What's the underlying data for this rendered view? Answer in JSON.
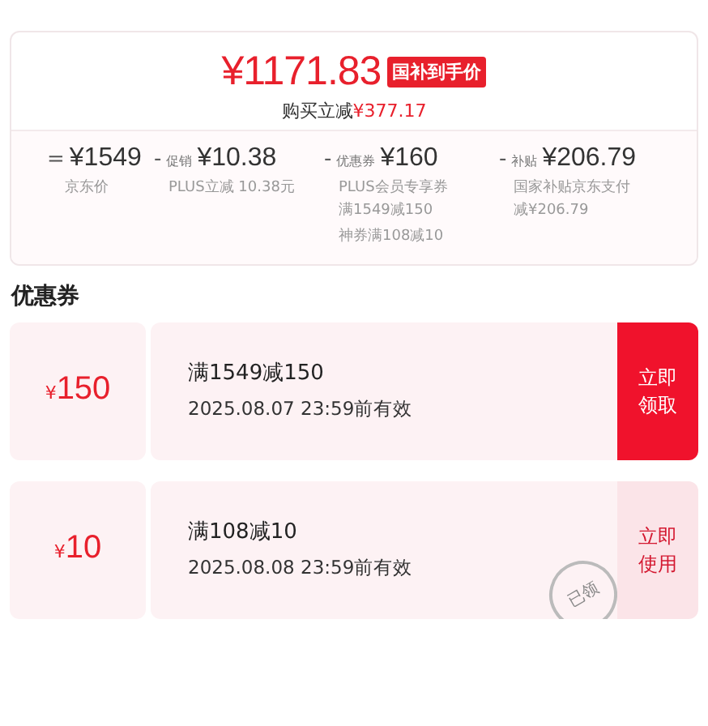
{
  "price_card": {
    "price": "¥1171.83",
    "badge": "国补到手价",
    "saving_label": "购买立减",
    "saving_amount": "¥377.17",
    "breakdown": [
      {
        "op": "=",
        "amount": "¥1549",
        "notes": [
          "京东价"
        ]
      },
      {
        "op": "-",
        "tag": "促销",
        "amount": "¥10.38",
        "notes": [
          "PLUS立减 10.38元"
        ]
      },
      {
        "op": "-",
        "tag": "优惠券",
        "amount": "¥160",
        "notes": [
          "PLUS会员专享券满1549减150",
          "神券满108减10"
        ]
      },
      {
        "op": "-",
        "tag": "补贴",
        "amount": "¥206.79",
        "notes": [
          "国家补贴京东支付减¥206.79"
        ]
      }
    ]
  },
  "coupons_title": "优惠券",
  "coupons": [
    {
      "currency": "¥",
      "value": "150",
      "condition": "满1549减150",
      "validity": "2025.08.07 23:59前有效",
      "action": "立即领取",
      "claimed": false
    },
    {
      "currency": "¥",
      "value": "10",
      "condition": "满108减10",
      "validity": "2025.08.08 23:59前有效",
      "action": "立即使用",
      "claimed": true,
      "stamp": "已领"
    }
  ]
}
